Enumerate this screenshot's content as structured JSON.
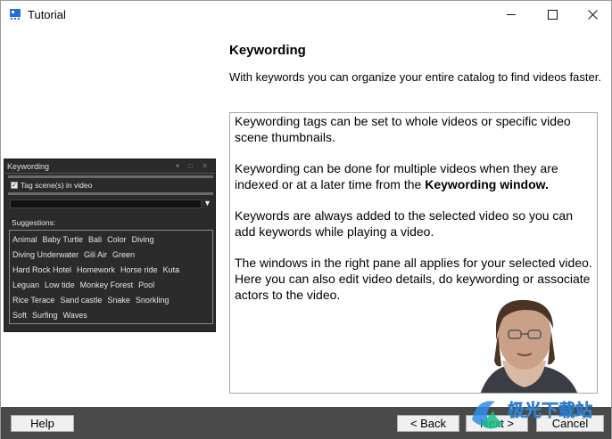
{
  "window": {
    "title": "Tutorial"
  },
  "keywording_panel": {
    "title": "Keywording",
    "checkbox_label": "Tag scene(s) in video",
    "suggestions_label": "Suggestions:",
    "suggestion_rows": [
      [
        "Animal",
        "Baby Turtle",
        "Bali",
        "Color",
        "Diving"
      ],
      [
        "Diving Underwater",
        "Gili Air",
        "Green"
      ],
      [
        "Hard Rock Hotel",
        "Homework",
        "Horse ride",
        "Kuta"
      ],
      [
        "Leguan",
        "Low tide",
        "Monkey Forest",
        "Pool"
      ],
      [
        "Rice Terace",
        "Sand castle",
        "Snake",
        "Snorkling"
      ],
      [
        "Soft",
        "Surfing",
        "Waves"
      ]
    ]
  },
  "main": {
    "heading": "Keywording",
    "intro": "With keywords you can organize your entire catalog to find videos faster.",
    "paragraphs": {
      "p1": "Keywording tags can be set to whole videos or specific video scene thumbnails.",
      "p2_before": "Keywording can be done for multiple videos when they are indexed or at a later time from the ",
      "p2_bold": "Keywording window.",
      "p3": "Keywords are always added to the selected video so you can add keywords while playing a video.",
      "p4": "The windows in the right pane all applies for your selected video. Here you can also edit video details, do keywording or associate actors to the video."
    }
  },
  "footer": {
    "help_label": "Help",
    "back_label": "< Back",
    "next_label": "Next >",
    "cancel_label": "Cancel"
  },
  "watermark": {
    "text": "极光下载站"
  },
  "colors": {
    "footer_bg": "#4a4a4a",
    "panel_bg": "#2b2b2b",
    "accent": "#1e6fd9"
  }
}
